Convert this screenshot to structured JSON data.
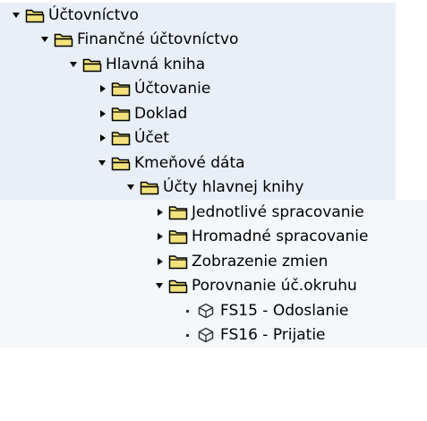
{
  "colors": {
    "row_bg": "#e9eff6",
    "row_alt": "#f5f8fb",
    "folder_fill": "#f3e27a",
    "folder_stroke": "#000000"
  },
  "tree": {
    "items": [
      {
        "label": "Účtovníctvo",
        "level": 0,
        "state": "expanded",
        "icon": "folder-open-icon",
        "highlight": "row_bg"
      },
      {
        "label": "Finančné účtovníctvo",
        "level": 1,
        "state": "expanded",
        "icon": "folder-open-icon",
        "highlight": "row_bg"
      },
      {
        "label": "Hlavná kniha",
        "level": 2,
        "state": "expanded",
        "icon": "folder-open-icon",
        "highlight": "row_bg"
      },
      {
        "label": "Účtovanie",
        "level": 3,
        "state": "collapsed",
        "icon": "folder-icon",
        "highlight": "row_bg"
      },
      {
        "label": "Doklad",
        "level": 3,
        "state": "collapsed",
        "icon": "folder-icon",
        "highlight": "row_bg"
      },
      {
        "label": "Účet",
        "level": 3,
        "state": "collapsed",
        "icon": "folder-icon",
        "highlight": "row_bg"
      },
      {
        "label": "Kmeňové dáta",
        "level": 3,
        "state": "expanded",
        "icon": "folder-open-icon",
        "highlight": "row_bg"
      },
      {
        "label": "Účty hlavnej knihy",
        "level": 4,
        "state": "expanded",
        "icon": "folder-open-icon",
        "highlight": "row_bg"
      },
      {
        "label": "Jednotlivé spracovanie",
        "level": 5,
        "state": "collapsed",
        "icon": "folder-icon",
        "highlight": "row_alt"
      },
      {
        "label": "Hromadné spracovanie",
        "level": 5,
        "state": "collapsed",
        "icon": "folder-icon",
        "highlight": "row_alt"
      },
      {
        "label": "Zobrazenie zmien",
        "level": 5,
        "state": "collapsed",
        "icon": "folder-icon",
        "highlight": "row_alt"
      },
      {
        "label": "Porovnanie úč.okruhu",
        "level": 5,
        "state": "expanded",
        "icon": "folder-open-icon",
        "highlight": "row_alt"
      },
      {
        "label": "FS15 - Odoslanie",
        "level": 6,
        "state": "leaf",
        "icon": "transaction-icon",
        "highlight": "row_alt"
      },
      {
        "label": "FS16 - Prijatie",
        "level": 6,
        "state": "leaf",
        "icon": "transaction-icon",
        "highlight": "row_alt"
      }
    ]
  }
}
